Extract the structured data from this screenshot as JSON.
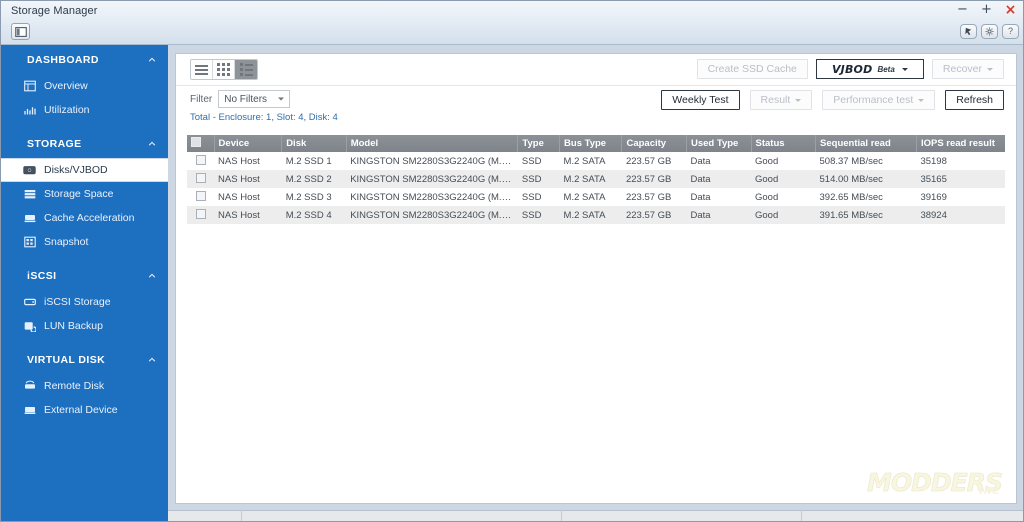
{
  "window": {
    "title": "Storage Manager",
    "controls": {
      "minimize": "−",
      "maximize": "+",
      "close": "×"
    },
    "quick_buttons": [
      {
        "name": "pointer-icon",
        "label": ""
      },
      {
        "name": "gear-icon",
        "label": ""
      },
      {
        "name": "help-icon",
        "label": "?"
      }
    ],
    "panel_toggle": "panel-toggle-icon"
  },
  "sidebar": {
    "groups": [
      {
        "title": "DASHBOARD",
        "expanded": true,
        "items": [
          {
            "label": "Overview",
            "icon": "overview-icon",
            "selected": false
          },
          {
            "label": "Utilization",
            "icon": "utilization-icon",
            "selected": false
          }
        ]
      },
      {
        "title": "STORAGE",
        "expanded": true,
        "items": [
          {
            "label": "Disks/VJBOD",
            "icon": "disk-icon",
            "selected": true
          },
          {
            "label": "Storage Space",
            "icon": "storage-space-icon",
            "selected": false
          },
          {
            "label": "Cache Acceleration",
            "icon": "cache-icon",
            "selected": false
          },
          {
            "label": "Snapshot",
            "icon": "snapshot-icon",
            "selected": false
          }
        ]
      },
      {
        "title": "iSCSI",
        "expanded": true,
        "items": [
          {
            "label": "iSCSI Storage",
            "icon": "iscsi-storage-icon",
            "selected": false
          },
          {
            "label": "LUN Backup",
            "icon": "lun-backup-icon",
            "selected": false
          }
        ]
      },
      {
        "title": "VIRTUAL DISK",
        "expanded": true,
        "items": [
          {
            "label": "Remote Disk",
            "icon": "remote-disk-icon",
            "selected": false
          },
          {
            "label": "External Device",
            "icon": "external-device-icon",
            "selected": false
          }
        ]
      }
    ]
  },
  "toolbar": {
    "view_modes": [
      {
        "name": "list-view",
        "active": false
      },
      {
        "name": "grid-view",
        "active": false
      },
      {
        "name": "detail-view",
        "active": true
      }
    ],
    "create_ssd_cache_label": "Create SSD Cache",
    "create_ssd_cache_disabled": true,
    "vjbod_label": "VJBOD",
    "vjbod_beta_label": "Beta",
    "recover_label": "Recover",
    "recover_disabled": true,
    "filter_label": "Filter",
    "filter_value": "No Filters",
    "weekly_test_label": "Weekly Test",
    "result_label": "Result",
    "result_disabled": true,
    "performance_test_label": "Performance test",
    "performance_test_disabled": true,
    "refresh_label": "Refresh"
  },
  "summary": {
    "total_line": "Total - Enclosure: 1, Slot: 4, Disk: 4"
  },
  "table": {
    "columns": [
      "Device",
      "Disk",
      "Model",
      "Type",
      "Bus Type",
      "Capacity",
      "Used Type",
      "Status",
      "Sequential read",
      "IOPS read result"
    ],
    "rows": [
      {
        "device": "NAS Host",
        "disk": "M.2 SSD 1",
        "model": "KINGSTON SM2280S3G2240G (M.2 SAT...",
        "type": "SSD",
        "bus_type": "M.2 SATA",
        "capacity": "223.57 GB",
        "used_type": "Data",
        "status": "Good",
        "sequential_read": "508.37 MB/sec",
        "iops_read_result": "35198"
      },
      {
        "device": "NAS Host",
        "disk": "M.2 SSD 2",
        "model": "KINGSTON SM2280S3G2240G (M.2 SAT...",
        "type": "SSD",
        "bus_type": "M.2 SATA",
        "capacity": "223.57 GB",
        "used_type": "Data",
        "status": "Good",
        "sequential_read": "514.00 MB/sec",
        "iops_read_result": "35165"
      },
      {
        "device": "NAS Host",
        "disk": "M.2 SSD 3",
        "model": "KINGSTON SM2280S3G2240G (M.2 SAT...",
        "type": "SSD",
        "bus_type": "M.2 SATA",
        "capacity": "223.57 GB",
        "used_type": "Data",
        "status": "Good",
        "sequential_read": "392.65 MB/sec",
        "iops_read_result": "39169"
      },
      {
        "device": "NAS Host",
        "disk": "M.2 SSD 4",
        "model": "KINGSTON SM2280S3G2240G (M.2 SAT...",
        "type": "SSD",
        "bus_type": "M.2 SATA",
        "capacity": "223.57 GB",
        "used_type": "Data",
        "status": "Good",
        "sequential_read": "391.65 MB/sec",
        "iops_read_result": "38924"
      }
    ]
  },
  "watermark": {
    "main": "MODDERS",
    "sub": "INC"
  },
  "colors": {
    "sidebar_blue": "#1d6fc0",
    "accent_link": "#2e6fb0",
    "table_header": "#8b9196",
    "close_red": "#d33b2c"
  }
}
